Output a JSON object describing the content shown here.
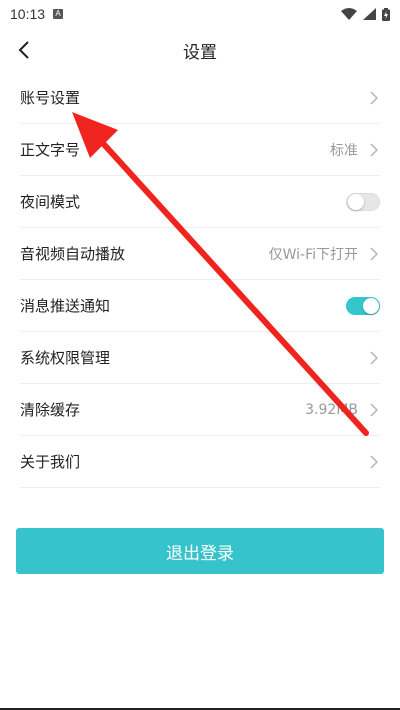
{
  "status": {
    "time": "10:13",
    "notification_icon": "A"
  },
  "header": {
    "title": "设置"
  },
  "rows": [
    {
      "label": "账号设置",
      "value": ""
    },
    {
      "label": "正文字号",
      "value": "标准"
    },
    {
      "label": "夜间模式",
      "toggle": false
    },
    {
      "label": "音视频自动播放",
      "value": "仅Wi-Fi下打开"
    },
    {
      "label": "消息推送通知",
      "toggle": true
    },
    {
      "label": "系统权限管理",
      "value": ""
    },
    {
      "label": "清除缓存",
      "value": "3.92MB"
    },
    {
      "label": "关于我们",
      "value": ""
    }
  ],
  "logout_label": "退出登录",
  "colors": {
    "accent": "#37c3cc",
    "annotation": "#f0241e"
  }
}
